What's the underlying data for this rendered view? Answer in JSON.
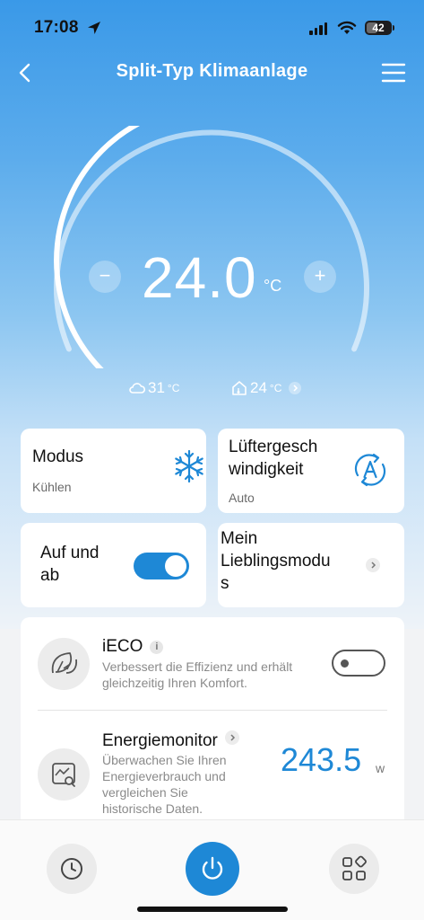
{
  "status_bar": {
    "time": "17:08",
    "battery": "42",
    "icons": [
      "location-arrow-icon",
      "cellular-signal-icon",
      "wifi-icon",
      "battery-icon"
    ]
  },
  "nav": {
    "title": "Split-Typ Klimaanlage",
    "back_icon": "chevron-left-icon",
    "menu_icon": "hamburger-menu-icon"
  },
  "thermostat": {
    "target_temp": "24.0",
    "unit": "°C",
    "minus_label": "−",
    "plus_label": "+",
    "setpoint_fraction": 0.5,
    "outdoor_temp": "31",
    "indoor_temp": "24",
    "small_unit": "°C"
  },
  "cards": {
    "mode": {
      "title": "Modus",
      "value": "Kühlen",
      "icon": "snowflake-icon"
    },
    "fan": {
      "title_line1": "Lüftergesch",
      "title_line2": "windigkeit",
      "value": "Auto",
      "icon": "auto-fan-icon"
    },
    "swing": {
      "title_line1": "Auf und",
      "title_line2": "ab",
      "enabled": true
    },
    "favorite": {
      "title_line1": "Mein",
      "title_line2": "Lieblingsmodu",
      "title_line3": "s"
    }
  },
  "ieco": {
    "title": "iECO",
    "info": "i",
    "desc_line1": "Verbessert die Effizienz und erhält",
    "desc_line2": "gleichzeitig Ihren Komfort.",
    "enabled": false
  },
  "energy": {
    "title": "Energiemonitor",
    "desc_line1": "Überwachen Sie Ihren",
    "desc_line2": "Energieverbrauch und",
    "desc_line3": "vergleichen Sie",
    "desc_line4": "historische Daten.",
    "value": "243.5",
    "unit": "w"
  },
  "bottom_bar": {
    "icons": [
      "clock-icon",
      "power-icon",
      "apps-grid-icon"
    ]
  },
  "colors": {
    "accent": "#1e88d6",
    "hero_top": "#3a99e8",
    "hero_bottom": "#eef3f8"
  }
}
